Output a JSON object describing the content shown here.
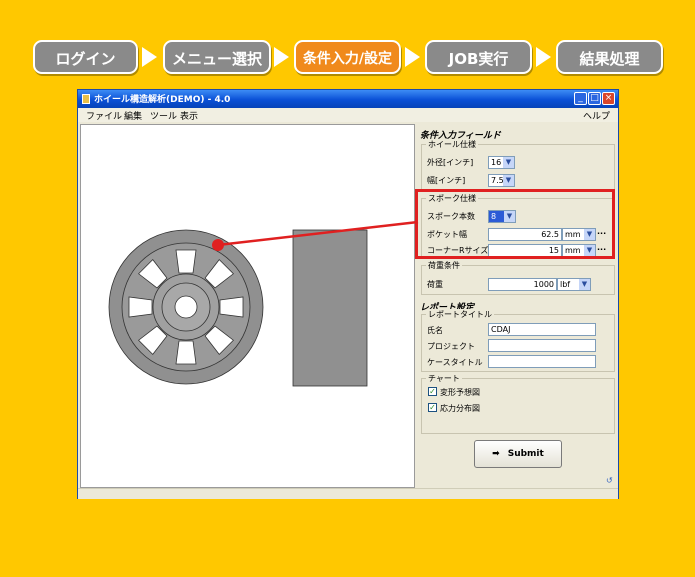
{
  "steps": [
    {
      "label": "ログイン",
      "active": false
    },
    {
      "label": "メニュー選択",
      "active": false
    },
    {
      "label": "条件入力/設定",
      "active": true
    },
    {
      "label": "JOB実行",
      "active": false
    },
    {
      "label": "結果処理",
      "active": false
    }
  ],
  "window": {
    "title": "ホイール構造解析(DEMO) - 4.0",
    "menu": [
      "ファイル",
      "編集",
      "ツール",
      "表示"
    ],
    "help": "ヘルプ"
  },
  "panel": {
    "conditions_title": "条件入力フィールド",
    "wheel_spec": {
      "title": "ホイール仕様",
      "diameter_label": "外径[インチ]",
      "diameter_value": "16",
      "width_label": "幅[インチ]",
      "width_value": "7.5"
    },
    "spoke_spec": {
      "title": "スポーク仕様",
      "count_label": "スポーク本数",
      "count_value": "8",
      "pocket_label": "ポケット幅",
      "pocket_value": "62.5",
      "pocket_unit": "mm",
      "corner_label": "コーナーRサイズ",
      "corner_value": "15",
      "corner_unit": "mm",
      "more": "..."
    },
    "load": {
      "title": "荷重条件",
      "load_label": "荷重",
      "load_value": "1000",
      "load_unit": "lbf"
    },
    "report_title": "レポート設定",
    "report": {
      "title": "レポートタイトル",
      "name_label": "氏名",
      "name_value": "CDAJ",
      "project_label": "プロジェクト",
      "project_value": "",
      "case_label": "ケースタイトル",
      "case_value": ""
    },
    "chart": {
      "title": "チャート",
      "deform_label": "変形予想図",
      "stress_label": "応力分布図"
    },
    "submit_label": "Submit"
  },
  "icons": [
    "app-icon",
    "minimize-icon",
    "maximize-icon",
    "close-icon",
    "chevron-down-icon",
    "checkmark-icon",
    "arrow-right-icon",
    "resize-grip-icon"
  ],
  "colors": {
    "background": "#FFC800",
    "step_active": "#F08A1C",
    "step_inactive": "#8A8A8A",
    "highlight": "#E02020",
    "wheel_fill": "#909090"
  }
}
